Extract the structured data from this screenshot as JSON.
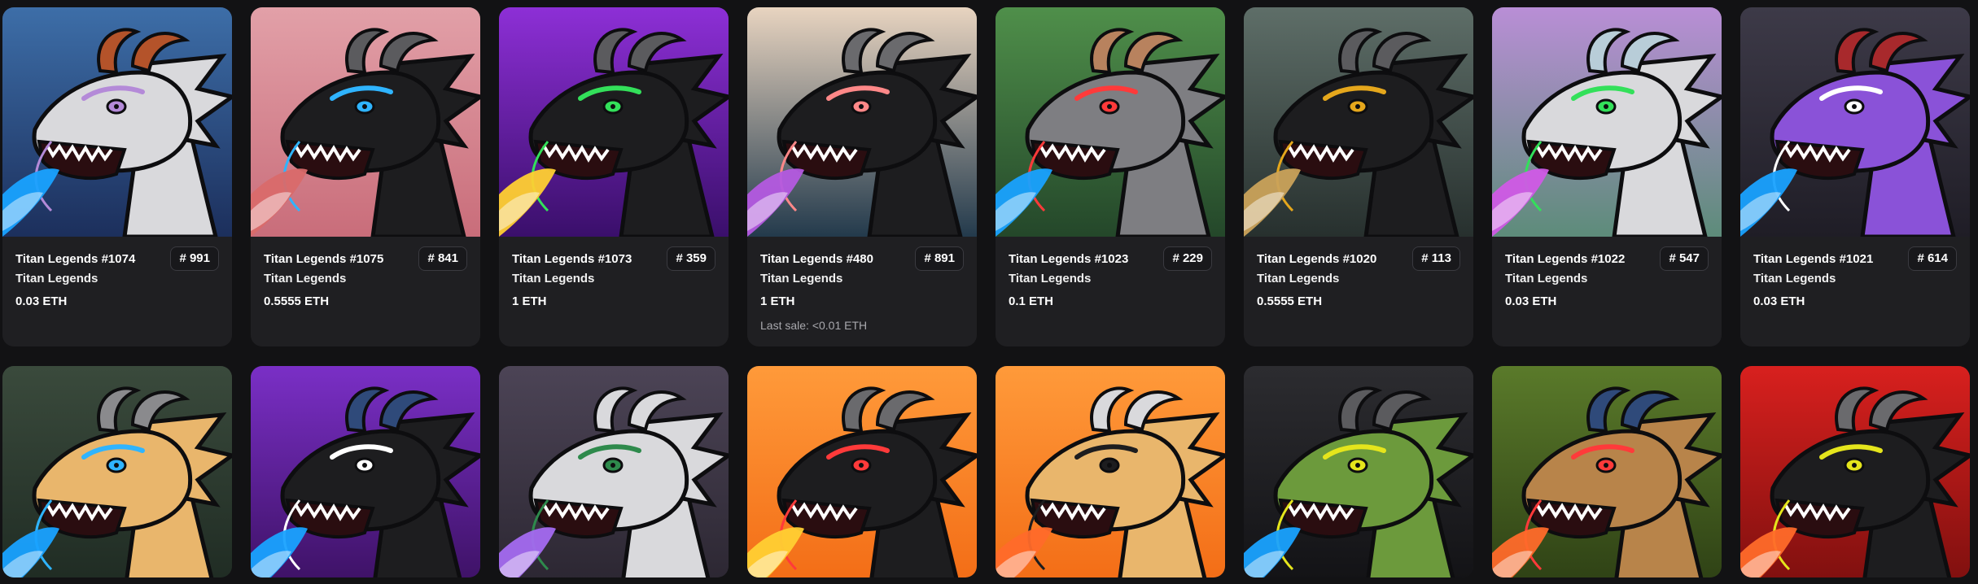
{
  "row1": [
    {
      "name": "Titan Legends #1074",
      "collection": "Titan Legends",
      "rank": "# 991",
      "price": "0.03 ETH",
      "last_sale": "",
      "bg1": "#3d6ea8",
      "bg2": "#1c2f5c",
      "head": "#d9d9dc",
      "eye": "#b48ad8",
      "horn": "#b4532a",
      "breath": "#19a2ff"
    },
    {
      "name": "Titan Legends #1075",
      "collection": "Titan Legends",
      "rank": "# 841",
      "price": "0.5555 ETH",
      "last_sale": "",
      "bg1": "#e2a0a8",
      "bg2": "#c96d7a",
      "head": "#1d1d1f",
      "eye": "#2fb4ff",
      "horn": "#5b5b5e",
      "breath": "#d96a6a"
    },
    {
      "name": "Titan Legends #1073",
      "collection": "Titan Legends",
      "rank": "# 359",
      "price": "1 ETH",
      "last_sale": "",
      "bg1": "#8d2fd6",
      "bg2": "#3a0f6b",
      "head": "#1d1d1f",
      "eye": "#33e05a",
      "horn": "#5b5b5e",
      "breath": "#ffcf33"
    },
    {
      "name": "Titan Legends #480",
      "collection": "Titan Legends",
      "rank": "# 891",
      "price": "1 ETH",
      "last_sale": "Last sale: <0.01 ETH",
      "bg1": "#e8d4c0",
      "bg2": "#233a4c",
      "head": "#1d1d1f",
      "eye": "#ff8888",
      "horn": "#6a6a6d",
      "breath": "#b45ae0"
    },
    {
      "name": "Titan Legends #1023",
      "collection": "Titan Legends",
      "rank": "# 229",
      "price": "0.1 ETH",
      "last_sale": "",
      "bg1": "#4f8f4a",
      "bg2": "#24472a",
      "head": "#7e7e82",
      "eye": "#ff3a3a",
      "horn": "#b8825e",
      "breath": "#19a2ff"
    },
    {
      "name": "Titan Legends #1020",
      "collection": "Titan Legends",
      "rank": "# 113",
      "price": "0.5555 ETH",
      "last_sale": "",
      "bg1": "#5e6e68",
      "bg2": "#27302e",
      "head": "#1d1d1f",
      "eye": "#e5a71c",
      "horn": "#5b5b5e",
      "breath": "#caa25a"
    },
    {
      "name": "Titan Legends #1022",
      "collection": "Titan Legends",
      "rank": "# 547",
      "price": "0.03 ETH",
      "last_sale": "",
      "bg1": "#b98ed6",
      "bg2": "#5d8c7a",
      "head": "#d9d9dc",
      "eye": "#33e05a",
      "horn": "#b8cdd8",
      "breath": "#d05ae6"
    },
    {
      "name": "Titan Legends #1021",
      "collection": "Titan Legends",
      "rank": "# 614",
      "price": "0.03 ETH",
      "last_sale": "",
      "bg1": "#3d3a48",
      "bg2": "#1f1d26",
      "head": "#8a52d8",
      "eye": "#ffffff",
      "horn": "#a8292c",
      "breath": "#19a2ff"
    }
  ],
  "row2": [
    {
      "name": "",
      "collection": "",
      "rank": "",
      "price": "",
      "last_sale": "",
      "bg1": "#3a4a3c",
      "bg2": "#1e2a22",
      "head": "#e9b66c",
      "eye": "#2fb4ff",
      "horn": "#8a8a8d",
      "breath": "#19a2ff"
    },
    {
      "name": "",
      "collection": "",
      "rank": "",
      "price": "",
      "last_sale": "",
      "bg1": "#7a2fc6",
      "bg2": "#3a1060",
      "head": "#1d1d1f",
      "eye": "#ffffff",
      "horn": "#2f4a7a",
      "breath": "#19a2ff"
    },
    {
      "name": "",
      "collection": "",
      "rank": "",
      "price": "",
      "last_sale": "",
      "bg1": "#4c4456",
      "bg2": "#2a2530",
      "head": "#d9d9dc",
      "eye": "#2e8a4c",
      "horn": "#d9d9dc",
      "breath": "#a46af0"
    },
    {
      "name": "",
      "collection": "",
      "rank": "",
      "price": "",
      "last_sale": "",
      "bg1": "#ff9a3a",
      "bg2": "#f26a14",
      "head": "#1d1d1f",
      "eye": "#ff3a3a",
      "horn": "#6a6a6d",
      "breath": "#ffcf33"
    },
    {
      "name": "",
      "collection": "",
      "rank": "",
      "price": "",
      "last_sale": "",
      "bg1": "#ff9a3a",
      "bg2": "#f26a14",
      "head": "#e9b66c",
      "eye": "#1d1d1f",
      "horn": "#d9d9dc",
      "breath": "#ff6a2a"
    },
    {
      "name": "",
      "collection": "",
      "rank": "",
      "price": "",
      "last_sale": "",
      "bg1": "#2c2c30",
      "bg2": "#111114",
      "head": "#6c9a3c",
      "eye": "#e5e51c",
      "horn": "#5b5b5e",
      "breath": "#19a2ff"
    },
    {
      "name": "",
      "collection": "",
      "rank": "",
      "price": "",
      "last_sale": "",
      "bg1": "#5a7a2a",
      "bg2": "#2c3e14",
      "head": "#b8844a",
      "eye": "#ff3a3a",
      "horn": "#2f4a7a",
      "breath": "#ff6a2a"
    },
    {
      "name": "",
      "collection": "",
      "rank": "",
      "price": "",
      "last_sale": "",
      "bg1": "#d8201e",
      "bg2": "#7a0f0e",
      "head": "#1d1d1f",
      "eye": "#e5e51c",
      "horn": "#6a6a6d",
      "breath": "#ff6a2a"
    }
  ]
}
